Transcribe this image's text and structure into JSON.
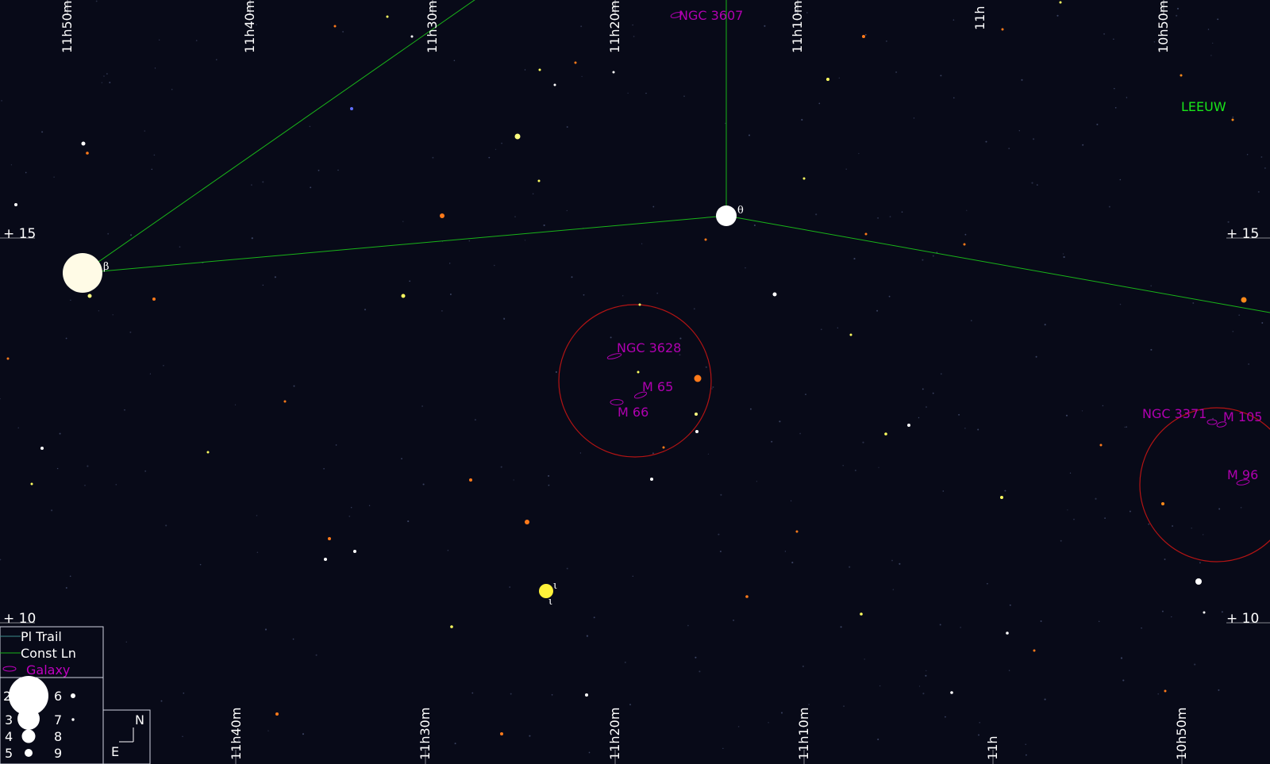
{
  "colors": {
    "background": "#080a18",
    "constellation_line": "#19b419",
    "galaxy": "#b000b0",
    "fov_circle": "#b41414",
    "constellation_label": "#19e619"
  },
  "ra_top": [
    "11h50m",
    "11h40m",
    "11h30m",
    "11h20m",
    "11h10m",
    "11h",
    "10h50m"
  ],
  "ra_bottom": [
    "11h40m",
    "11h30m",
    "11h20m",
    "11h10m",
    "11h",
    "10h50m"
  ],
  "dec": {
    "d15": "+ 15",
    "d10": "+ 10"
  },
  "constellation": {
    "name": "LEEUW"
  },
  "stars": {
    "beta": "β",
    "theta": "θ",
    "iota": "ι"
  },
  "galaxies": {
    "ngc3607": "NGC 3607",
    "ngc3628": "NGC 3628",
    "m65": "M 65",
    "m66": "M 66",
    "ngc3371": "NGC 3371",
    "m105": "M 105",
    "m96": "M 96"
  },
  "legend": {
    "pl_trail": "Pl Trail",
    "const_ln": "Const Ln",
    "galaxy": "Galaxy",
    "magnitudes": [
      "2",
      "3",
      "4",
      "5",
      "6",
      "7",
      "8",
      "9"
    ]
  },
  "compass": {
    "north": "N",
    "east": "E"
  }
}
